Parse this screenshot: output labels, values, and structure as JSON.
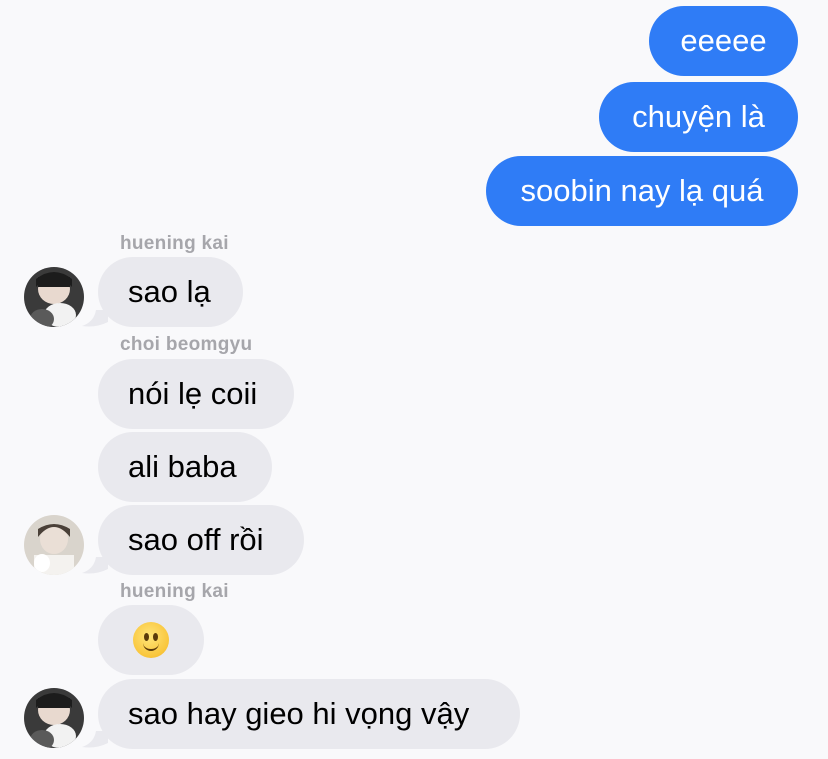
{
  "colors": {
    "background": "#f9f9fb",
    "outgoing_bubble": "#2f7cf6",
    "incoming_bubble": "#e9e9ee",
    "sender_name": "#a6a6ab"
  },
  "outgoing": [
    {
      "text": "eeeee"
    },
    {
      "text": "chuyện là"
    },
    {
      "text": "soobin nay lạ quá"
    }
  ],
  "groups": [
    {
      "sender": "huening kai",
      "avatar_icon": "avatar-huening-kai-icon",
      "messages": [
        {
          "text": "sao lạ"
        }
      ]
    },
    {
      "sender": "choi beomgyu",
      "avatar_icon": "avatar-choi-beomgyu-icon",
      "messages": [
        {
          "text": "nói lẹ coii"
        },
        {
          "text": "ali baba"
        },
        {
          "text": "sao off rồi"
        }
      ]
    },
    {
      "sender": "huening kai",
      "avatar_icon": "avatar-huening-kai-icon",
      "messages": [
        {
          "emoji": "slightly-smiling-face-icon"
        },
        {
          "text": "sao hay gieo hi vọng vậy"
        }
      ]
    }
  ]
}
